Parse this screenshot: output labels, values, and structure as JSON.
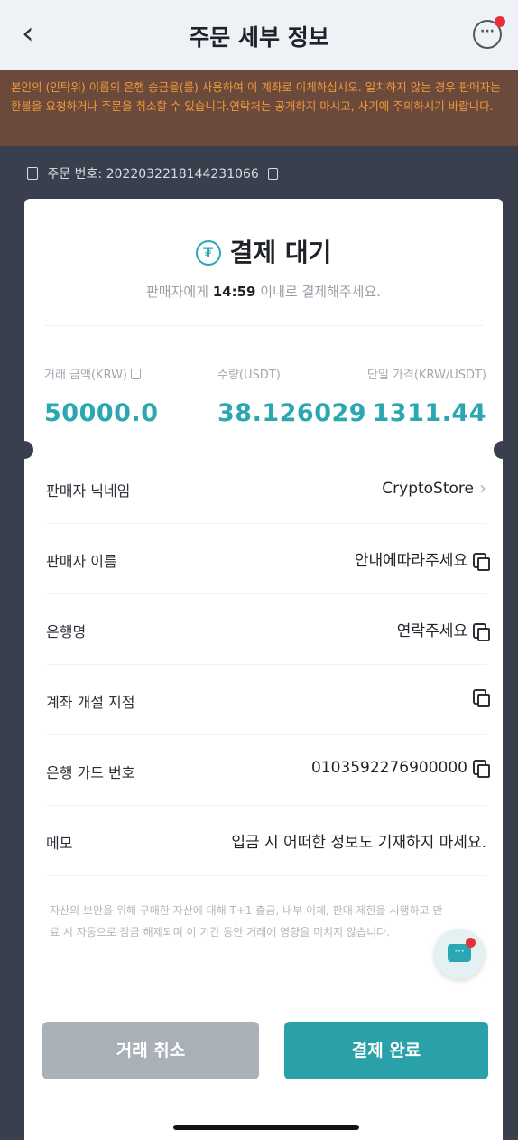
{
  "header": {
    "back_icon": "chevron-left-icon",
    "title": "주문 세부 정보",
    "chat_icon": "chat-icon"
  },
  "warning": {
    "text": "본인의 (인탁위) 이름의 은행 송금을(를) 사용하여 이 계좌로 이체하십시오. 일치하지 않는 경우 판매자는 환불을 요청하거나 주문을 취소할 수 있습니다.연락처는 공개하지 마시고, 사기에 주의하시기 바랍니다."
  },
  "order": {
    "label": "주문 번호:",
    "number": "2022032218144231066"
  },
  "status": {
    "title": "결제 대기",
    "sub_prefix": "판매자에게",
    "timer": "14:59",
    "sub_suffix": "이내로 결제해주세요."
  },
  "metrics": [
    {
      "label": "거래 금액(KRW)",
      "value": "50000.0"
    },
    {
      "label": "수량(USDT)",
      "value": "38.126029"
    },
    {
      "label": "단일 가격(KRW/USDT)",
      "value": "1311.44"
    }
  ],
  "rows": [
    {
      "key": "판매자 닉네임",
      "value": "CryptoStore"
    },
    {
      "key": "판매자 이름",
      "value": "안내에따라주세요"
    },
    {
      "key": "은행명",
      "value": "연락주세요"
    },
    {
      "key": "계좌 개설 지점",
      "value": ""
    },
    {
      "key": "은행 카드 번호",
      "value": "0103592276900000"
    },
    {
      "key": "메모",
      "value": "입금 시 어떠한 정보도 기재하지 마세요."
    }
  ],
  "disclaimer": "자산의 보안을 위해 구매한 자산에 대해 T+1 출금, 내부 이체, 판매 제한을 시행하고 만료 시 자동으로 잠금 해제되며 이 기간 동안 거래에 영향을 미치지 않습니다.",
  "buttons": {
    "cancel": "거래 취소",
    "done": "결제 완료"
  },
  "colors": {
    "accent": "#2aa7b0",
    "warning_text": "#f09a3a",
    "warning_bg": "#6b4a3c",
    "background": "#3a3f4d"
  }
}
